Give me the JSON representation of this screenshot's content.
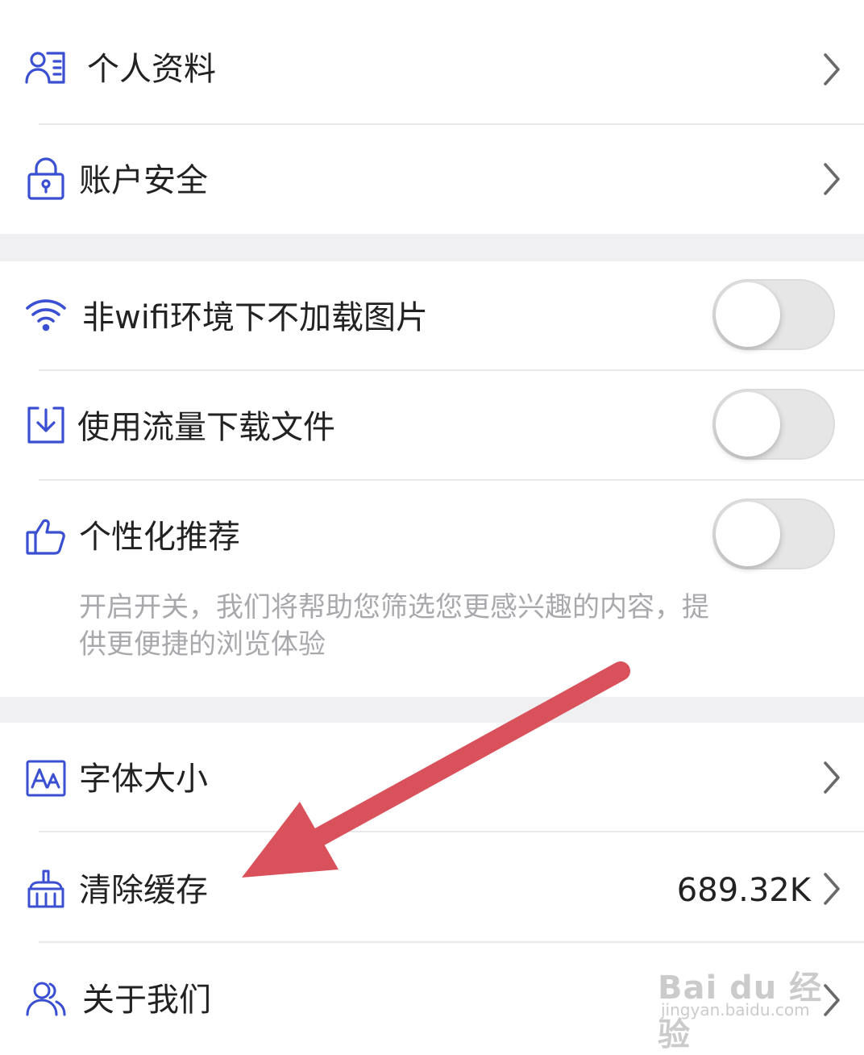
{
  "groups": {
    "account": {
      "profile": {
        "label": "个人资料",
        "icon": "profile-card-icon"
      },
      "security": {
        "label": "账户安全",
        "icon": "lock-icon"
      }
    },
    "network": {
      "wifi_images": {
        "label": "非wifi环境下不加载图片",
        "icon": "wifi-icon",
        "enabled": false
      },
      "data_download": {
        "label": "使用流量下载文件",
        "icon": "download-icon",
        "enabled": false
      },
      "recommend": {
        "label": "个性化推荐",
        "icon": "thumbs-up-icon",
        "enabled": false,
        "description": "开启开关，我们将帮助您筛选您更感兴趣的内容，提供更便捷的浏览体验"
      }
    },
    "general": {
      "font_size": {
        "label": "字体大小",
        "icon": "font-size-icon"
      },
      "clear_cache": {
        "label": "清除缓存",
        "icon": "broom-icon",
        "value": "689.32K"
      },
      "about": {
        "label": "关于我们",
        "icon": "group-users-icon"
      }
    }
  },
  "watermark": {
    "main": "Bai du 经验",
    "sub": "jingyan.baidu.com"
  },
  "colors": {
    "icon_accent": "#3a4fd1",
    "arrow": "#d9515a",
    "separator_band": "#f0f0f3",
    "toggle_off": "#e6e6e6"
  }
}
